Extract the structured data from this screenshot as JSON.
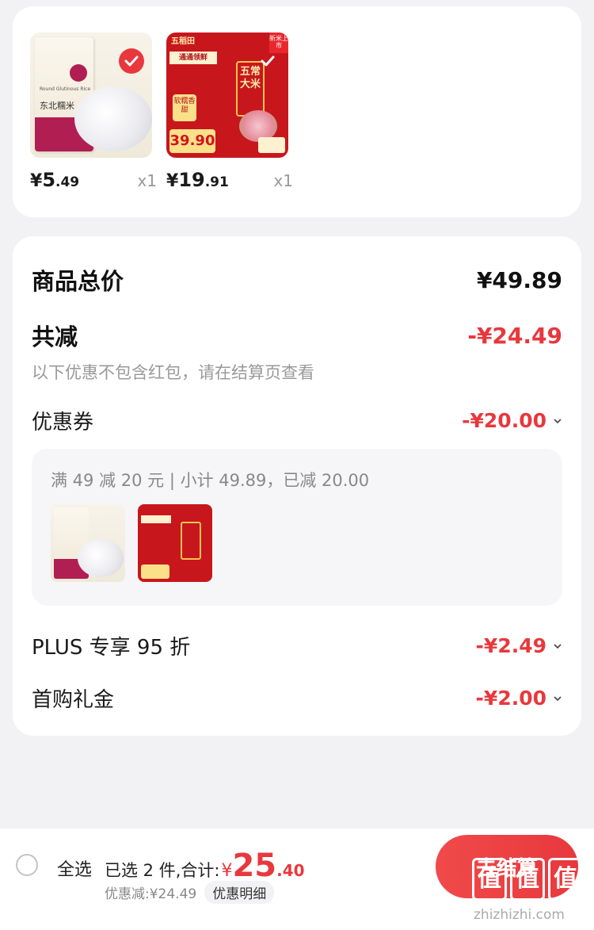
{
  "products": [
    {
      "price_yen": "¥",
      "price_int": "5",
      "price_dec": ".49",
      "qty": "x1",
      "image": {
        "bag_text_en": "Round Glutinous Rice",
        "bag_text_cn": "东北糯米"
      },
      "selected": true
    },
    {
      "price_yen": "¥",
      "price_int": "19",
      "price_dec": ".91",
      "qty": "x1",
      "image": {
        "top_label": "五稻田",
        "banner": "通通领鲜",
        "vertical_text": "五常大米",
        "soft_text": "软糯香甜",
        "price_tag": "39.90",
        "new_badge": "新米上市"
      },
      "selected": true
    }
  ],
  "summary": {
    "total_label": "商品总价",
    "total_value": "¥49.89",
    "reduce_label": "共减",
    "reduce_value": "-¥24.49",
    "note": "以下优惠不包含红包，请在结算页查看",
    "coupon_label": "优惠券",
    "coupon_value": "-¥20.00",
    "coupon_desc": "满 49 减 20 元 | 小计 49.89，已减 20.00",
    "plus_label": "PLUS 专享 95 折",
    "plus_value": "-¥2.49",
    "gift_label": "首购礼金",
    "gift_value": "-¥2.00"
  },
  "bottom_bar": {
    "select_all": "全选",
    "selected_text": "已选 2 件,合计:",
    "total_yen": "¥",
    "total_int": "25",
    "total_dec": ".40",
    "discount_text": "优惠减:¥24.49",
    "detail_label": "优惠明细",
    "checkout_label": "去结算"
  },
  "watermark": {
    "chars": [
      "值",
      "值",
      "值"
    ],
    "url": "zhizhizhi.com"
  },
  "colors": {
    "accent_red": "#e8383d",
    "background": "#f2f2f4"
  }
}
